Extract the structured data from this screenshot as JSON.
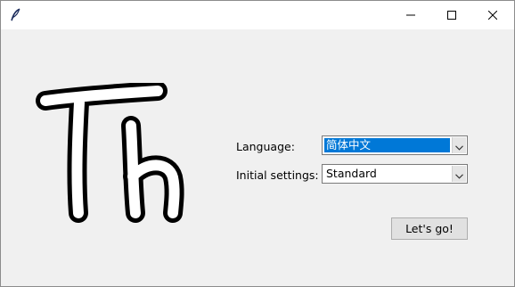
{
  "window": {
    "title": "",
    "app_icon": "feather-icon",
    "controls": [
      "minimize-icon",
      "maximize-icon",
      "close-icon"
    ]
  },
  "logo": {
    "text": "Th"
  },
  "form": {
    "language_label": "Language:",
    "language_value": "简体中文",
    "initial_settings_label": "Initial settings:",
    "initial_settings_value": "Standard"
  },
  "actions": {
    "go_label": "Let's go!"
  },
  "colors": {
    "selection": "#0078d7",
    "window_bg": "#f0f0f0",
    "titlebar_bg": "#ffffff"
  }
}
